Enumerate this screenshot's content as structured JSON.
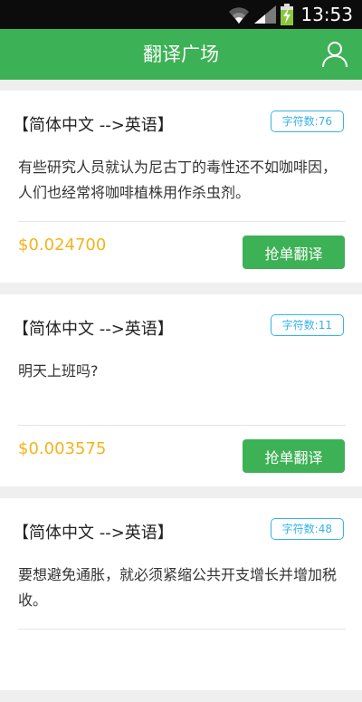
{
  "status_bar": {
    "time": "13:53",
    "icons": [
      "wifi-icon",
      "signal-icon",
      "battery-charging-icon"
    ]
  },
  "header": {
    "title": "翻译广场",
    "user_icon": "user-icon"
  },
  "colors": {
    "primary_green": "#3db155",
    "badge_blue": "#35b3e8",
    "price_gold": "#f4b31b"
  },
  "tasks": [
    {
      "language": "【简体中文 -->英语】",
      "char_count": "字符数:76",
      "text": "有些研究人员就认为尼古丁的毒性还不如咖啡因，人们也经常将咖啡植株用作杀虫剂。",
      "price": "$0.024700",
      "action_label": "抢单翻译"
    },
    {
      "language": "【简体中文 -->英语】",
      "char_count": "字符数:11",
      "text": "明天上班吗?",
      "price": "$0.003575",
      "action_label": "抢单翻译"
    },
    {
      "language": "【简体中文 -->英语】",
      "char_count": "字符数:48",
      "text": "要想避免通胀，就必须紧缩公共开支增长并增加税收。",
      "price": "",
      "action_label": ""
    }
  ]
}
